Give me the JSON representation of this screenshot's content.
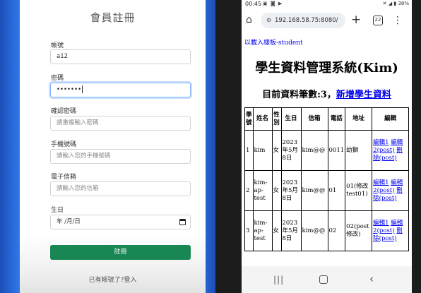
{
  "register_form": {
    "title": "會員註冊",
    "fields": [
      {
        "label": "帳號",
        "value": "a12",
        "placeholder": ""
      },
      {
        "label": "密碼",
        "value": "•••••••",
        "placeholder": ""
      },
      {
        "label": "確認密碼",
        "value": "",
        "placeholder": "請重複輸入密碼"
      },
      {
        "label": "手機號碼",
        "value": "",
        "placeholder": "請輸入您的手機號碼"
      },
      {
        "label": "電子信箱",
        "value": "",
        "placeholder": "請輸入您的信箱"
      },
      {
        "label": "生日",
        "value": "年 /月/日",
        "placeholder": ""
      }
    ],
    "submit_label": "註冊",
    "login_link": "已有帳號了?登入"
  },
  "phone": {
    "status": {
      "time": "00:45",
      "battery": "38%"
    },
    "browser": {
      "url": "192.168.58.75:8080/",
      "tab_count": "22"
    },
    "page": {
      "library_link": "以載入樣板-student",
      "heading": "學生資料管理系統(Kim)",
      "count_label": "目前資料筆數:3，",
      "add_link": "新增學生資料",
      "table": {
        "headers": [
          "學號",
          "姓名",
          "性別",
          "生日",
          "信箱",
          "電話",
          "地址",
          "編輯"
        ],
        "rows": [
          {
            "id": "1",
            "name": "kim",
            "gender": "女",
            "birthday": "2023年5月8日",
            "email": "kim@@",
            "phone": "0011",
            "address": "幼獅",
            "edit1": "編輯1",
            "edit2": "編輯2(post)",
            "delete": "刪除(post)"
          },
          {
            "id": "2",
            "name": "kim-ap-test",
            "gender": "女",
            "birthday": "2023年5月8日",
            "email": "kim@@",
            "phone": "01",
            "address": "01(修改test01)",
            "edit1": "編輯1",
            "edit2": "編輯2(post)",
            "delete": "刪除(post)"
          },
          {
            "id": "3",
            "name": "kim-ap-test",
            "gender": "女",
            "birthday": "2023年5月8日",
            "email": "kim@@",
            "phone": "02",
            "address": "02(post修改)",
            "edit1": "編輯1",
            "edit2": "編輯2(post)",
            "delete": "刪除(post)"
          }
        ]
      }
    }
  }
}
